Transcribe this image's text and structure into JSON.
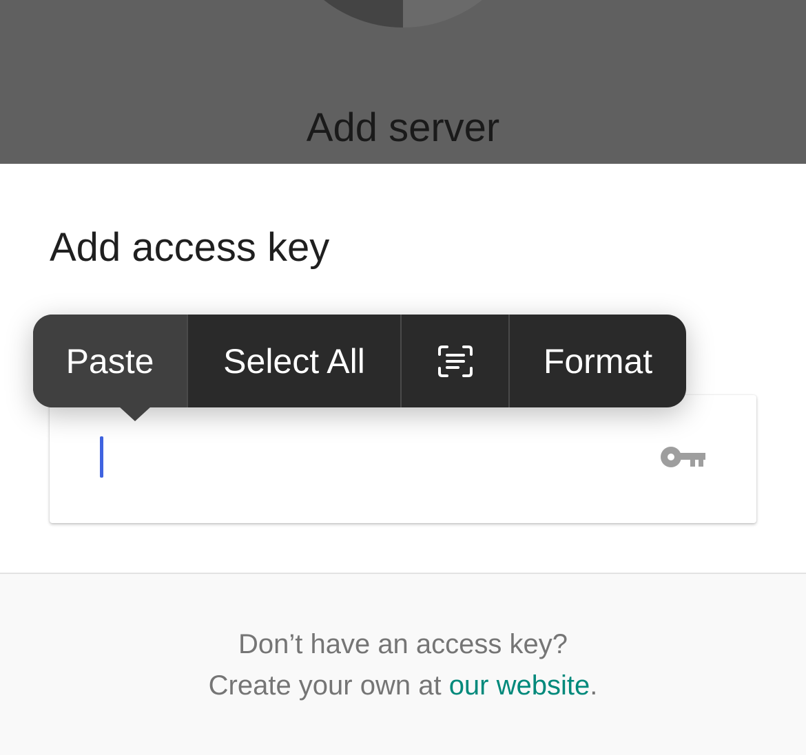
{
  "backdrop": {
    "title": "Add server"
  },
  "sheet": {
    "title": "Add access key",
    "key_field": {
      "value": "",
      "placeholder": "",
      "icon": "key-icon"
    }
  },
  "context_menu": {
    "items": [
      {
        "label": "Paste",
        "highlighted": true
      },
      {
        "label": "Select All"
      },
      {
        "label": "",
        "icon": "scan-text-icon"
      },
      {
        "label": "Format"
      }
    ]
  },
  "footer": {
    "line1": "Don’t have an access key?",
    "line2_prefix": "Create your own at ",
    "link_text": "our website",
    "line2_suffix": ".",
    "link_color": "#00897b"
  },
  "colors": {
    "backdrop": "#606060",
    "caret": "#3f63e0",
    "menu_background": "#2a2a2a",
    "menu_highlight": "#404040"
  }
}
